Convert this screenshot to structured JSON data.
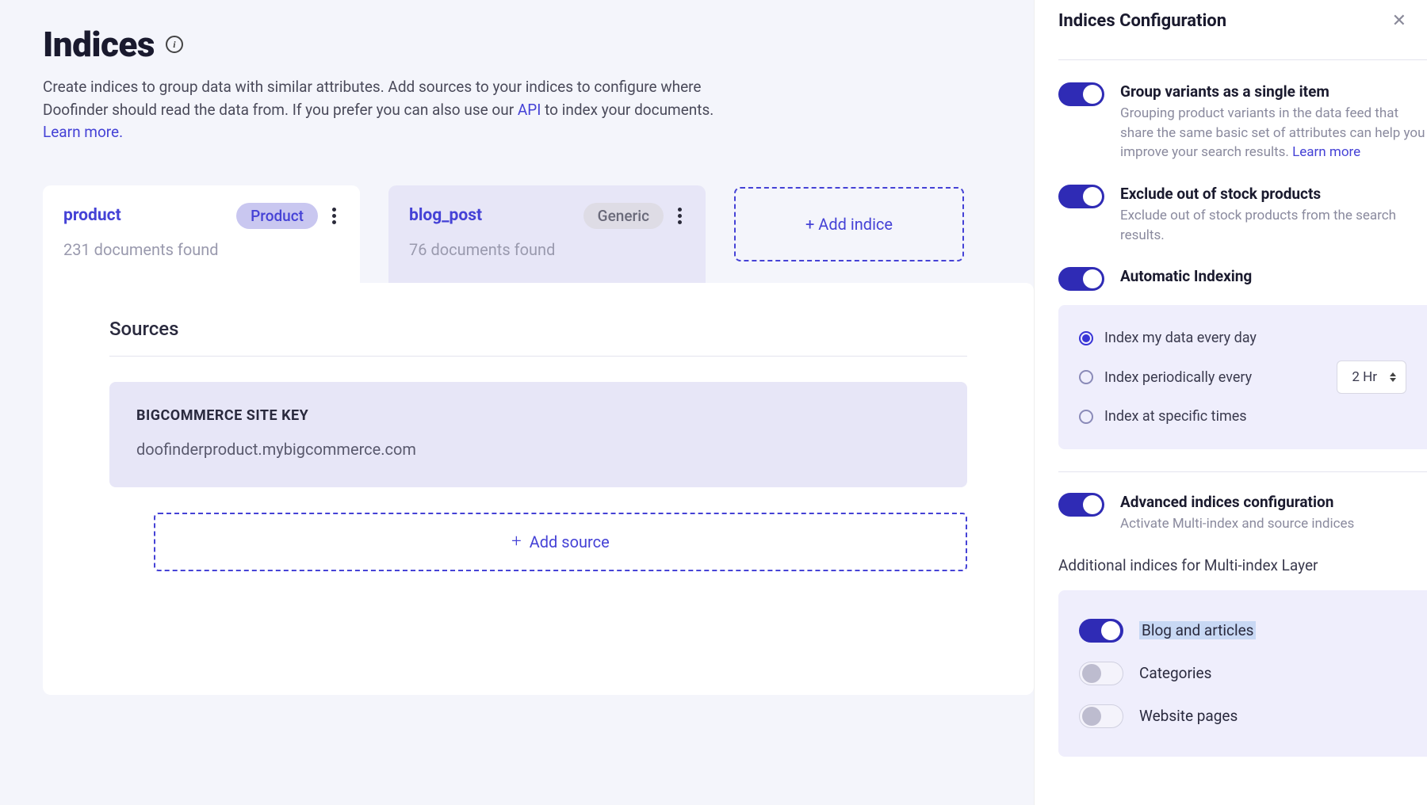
{
  "header": {
    "title": "Indices",
    "desc_pre": "Create indices to group data with similar attributes. Add sources to your indices to configure where Doofinder should read the data from. If you prefer you can also use our ",
    "api_link": "API",
    "desc_post": " to index your documents. ",
    "learn_more": "Learn more."
  },
  "tabs": [
    {
      "name": "product",
      "badge": "Product",
      "badge_class": "product",
      "docs": "231 documents found",
      "active": true
    },
    {
      "name": "blog_post",
      "badge": "Generic",
      "badge_class": "generic",
      "docs": "76 documents found",
      "active": false
    }
  ],
  "add_indice_label": "+ Add indice",
  "sources": {
    "title": "Sources",
    "box_label": "BIGCOMMERCE SITE KEY",
    "box_value": "doofinderproduct.mybigcommerce.com",
    "add_source_label": "Add source"
  },
  "sidebar": {
    "title": "Indices Configuration",
    "group_variants": {
      "label": "Group variants as a single item",
      "desc_pre": "Grouping product variants in the data feed that share the same basic set of attributes can help you improve your search results. ",
      "learn_more": "Learn more",
      "on": true
    },
    "exclude_oos": {
      "label": "Exclude out of stock products",
      "desc": "Exclude out of stock products from the search results.",
      "on": true
    },
    "auto_index": {
      "label": "Automatic Indexing",
      "on": true,
      "options": {
        "daily": "Index my data every day",
        "periodic": "Index periodically every",
        "periodic_value": "2 Hr",
        "specific": "Index at specific times",
        "selected": "daily"
      }
    },
    "advanced": {
      "label": "Advanced indices configuration",
      "desc": "Activate Multi-index and source indices",
      "on": true
    },
    "multi_index_heading": "Additional indices for Multi-index Layer",
    "multi_index": [
      {
        "label": "Blog and articles",
        "on": true,
        "highlight": true
      },
      {
        "label": "Categories",
        "on": false,
        "highlight": false
      },
      {
        "label": "Website pages",
        "on": false,
        "highlight": false
      }
    ]
  }
}
